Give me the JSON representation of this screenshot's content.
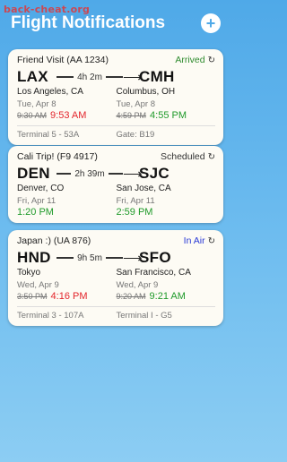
{
  "watermark": "back-cheat.org",
  "header": {
    "title": "Flight Notifications",
    "add_icon": "plus-icon",
    "add_glyph": "+"
  },
  "colors": {
    "arrived": "#2e8b2e",
    "scheduled": "#333333",
    "in_air": "#2a3ad6",
    "late": "#e3242b",
    "on_time": "#1f9a2a"
  },
  "flights": [
    {
      "title": "Friend Visit (AA 1234)",
      "status": "Arrived",
      "duration": "4h 2m",
      "from": {
        "code": "LAX",
        "city": "Los Angeles, CA",
        "date": "Tue, Apr 8",
        "scheduled": "9:30 AM",
        "actual": "9:53 AM",
        "terminal": "Terminal 5 - 53A"
      },
      "to": {
        "code": "CMH",
        "city": "Columbus, OH",
        "date": "Tue, Apr 8",
        "scheduled": "4:59 PM",
        "actual": "4:55 PM",
        "terminal": "Gate: B19"
      }
    },
    {
      "title": "Cali Trip! (F9 4917)",
      "status": "Scheduled",
      "duration": "2h 39m",
      "from": {
        "code": "DEN",
        "city": "Denver, CO",
        "date": "Fri, Apr 11",
        "scheduled": "",
        "actual": "1:20 PM",
        "terminal": ""
      },
      "to": {
        "code": "SJC",
        "city": "San Jose, CA",
        "date": "Fri, Apr 11",
        "scheduled": "",
        "actual": "2:59 PM",
        "terminal": ""
      }
    },
    {
      "title": "Japan :) (UA 876)",
      "status": "In Air",
      "duration": "9h 5m",
      "from": {
        "code": "HND",
        "city": "Tokyo",
        "date": "Wed, Apr 9",
        "scheduled": "3:50 PM",
        "actual": "4:16 PM",
        "terminal": "Terminal 3 - 107A"
      },
      "to": {
        "code": "SFO",
        "city": "San Francisco, CA",
        "date": "Wed, Apr 9",
        "scheduled": "9:20 AM",
        "actual": "9:21 AM",
        "terminal": "Terminal I - G5"
      }
    }
  ]
}
